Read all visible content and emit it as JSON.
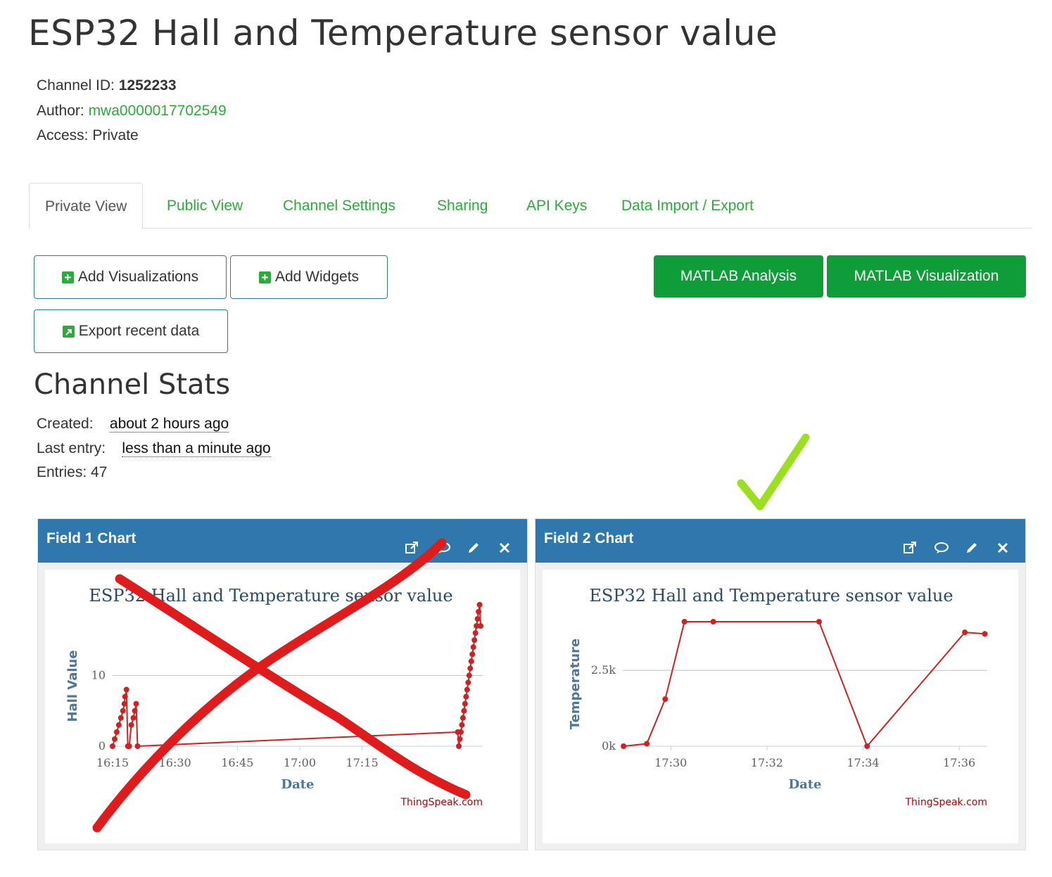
{
  "page": {
    "title": "ESP32 Hall and Temperature sensor value"
  },
  "channel": {
    "id_label": "Channel ID:",
    "id_value": "1252233",
    "author_label": "Author:",
    "author_value": "mwa0000017702549",
    "access_label": "Access:",
    "access_value": "Private"
  },
  "tabs": [
    {
      "label": "Private View"
    },
    {
      "label": "Public View"
    },
    {
      "label": "Channel Settings"
    },
    {
      "label": "Sharing"
    },
    {
      "label": "API Keys"
    },
    {
      "label": "Data Import / Export"
    }
  ],
  "buttons": {
    "add_visualizations": "Add Visualizations",
    "add_widgets": "Add Widgets",
    "export_recent": "Export recent data",
    "matlab_analysis": "MATLAB Analysis",
    "matlab_visualization": "MATLAB Visualization"
  },
  "stats": {
    "title": "Channel Stats",
    "created_label": "Created:",
    "created_value": "about 2 hours ago",
    "last_label": "Last entry:",
    "last_value": "less than a minute ago",
    "entries_label": "Entries:",
    "entries_value": "47"
  },
  "colors": {
    "accent": "#2bab3a",
    "panel_header": "#2e78ad",
    "line": "#cc2222",
    "annotation_x": "#e01b1b",
    "annotation_check": "#9be020"
  },
  "panels": [
    {
      "title": "Field 1 Chart",
      "icons": [
        "external-link-icon",
        "comment-icon",
        "pencil-icon",
        "close-icon"
      ]
    },
    {
      "title": "Field 2 Chart",
      "icons": [
        "external-link-icon",
        "comment-icon",
        "pencil-icon",
        "close-icon"
      ]
    }
  ],
  "chart_data": [
    {
      "type": "line",
      "title": "ESP32 Hall and Temperature sensor value",
      "xlabel": "Date",
      "ylabel": "Hall Value",
      "credit": "ThingSpeak.com",
      "x_ticks": [
        "16:15",
        "16:30",
        "16:45",
        "17:00",
        "17:15"
      ],
      "y_ticks": [
        "0",
        "10"
      ],
      "ylim": [
        0,
        17
      ],
      "xlim": [
        "16:15",
        "17:32"
      ],
      "series": [
        {
          "x": [
            "16:15",
            "16:15:30",
            "16:16",
            "16:16:30",
            "16:17",
            "16:17:30",
            "16:17:50",
            "16:18",
            "16:18:20",
            "16:18:40",
            "16:19",
            "16:19:30",
            "16:20",
            "16:20:20",
            "16:20:40",
            "16:21",
            "17:38",
            "17:38:15",
            "17:38:30",
            "17:38:45",
            "17:39",
            "17:39:15",
            "17:39:30",
            "17:39:45",
            "17:40",
            "17:40:15",
            "17:40:30",
            "17:40:45",
            "17:41",
            "17:41:15",
            "17:41:30",
            "17:41:45",
            "17:42",
            "17:42:15",
            "17:42:30",
            "17:42:45",
            "17:43",
            "17:43:15",
            "17:43:30"
          ],
          "y": [
            0,
            1,
            2,
            3,
            4,
            5,
            6,
            7,
            8,
            0,
            0,
            3,
            4,
            5,
            6,
            0,
            2,
            0,
            1,
            2,
            3,
            4,
            5,
            6,
            7,
            8,
            9,
            10,
            11,
            12,
            13,
            14,
            15,
            16,
            17,
            18,
            19,
            20,
            17
          ]
        }
      ]
    },
    {
      "type": "line",
      "title": "ESP32 Hall and Temperature sensor value",
      "xlabel": "Date",
      "ylabel": "Temperature",
      "credit": "ThingSpeak.com",
      "x_ticks": [
        "17:30",
        "17:32",
        "17:34",
        "17:36"
      ],
      "y_ticks": [
        "0k",
        "2.5k"
      ],
      "ylim": [
        0,
        4100
      ],
      "series": [
        {
          "x": [
            "17:29:01",
            "17:29:30",
            "17:29:53",
            "17:30:17",
            "17:30:53",
            "17:33:05",
            "17:34:05",
            "17:36:07",
            "17:36:32"
          ],
          "y": [
            0,
            80,
            1550,
            4100,
            4100,
            4100,
            0,
            3750,
            3700
          ]
        }
      ]
    }
  ]
}
